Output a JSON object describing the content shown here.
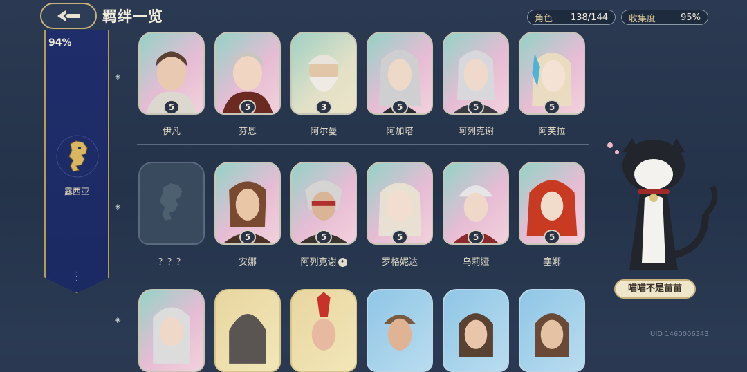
{
  "header": {
    "title": "羁绊一览",
    "back_icon": "arrow-back-icon"
  },
  "stats": {
    "role_label": "角色",
    "role_value": "138/144",
    "collect_label": "收集度",
    "collect_value": "95%"
  },
  "faction": {
    "percent": "94%",
    "name": "露西亚",
    "emblem_icon": "lion-emblem-icon"
  },
  "rows": [
    {
      "characters": [
        {
          "name": "伊凡",
          "stars": "5"
        },
        {
          "name": "芬恩",
          "stars": "5"
        },
        {
          "name": "阿尔曼",
          "stars": "3"
        },
        {
          "name": "阿加塔",
          "stars": "5"
        },
        {
          "name": "阿列克谢",
          "stars": "5"
        },
        {
          "name": "阿芙拉",
          "stars": "5"
        }
      ]
    },
    {
      "characters": [
        {
          "name": "？？？",
          "stars": ""
        },
        {
          "name": "安娜",
          "stars": "5"
        },
        {
          "name": "阿列克谢",
          "stars": "5"
        },
        {
          "name": "罗格妮达",
          "stars": "5"
        },
        {
          "name": "乌莉娅",
          "stars": "5"
        },
        {
          "name": "塞娜",
          "stars": "5"
        }
      ]
    }
  ],
  "companion": {
    "label": "喵喵不是苗苗"
  },
  "uid": "UID 1460006343",
  "colors": {
    "background": "#24334a",
    "faction_panel": "#1b2a63",
    "gold_border": "#c9b27a"
  }
}
